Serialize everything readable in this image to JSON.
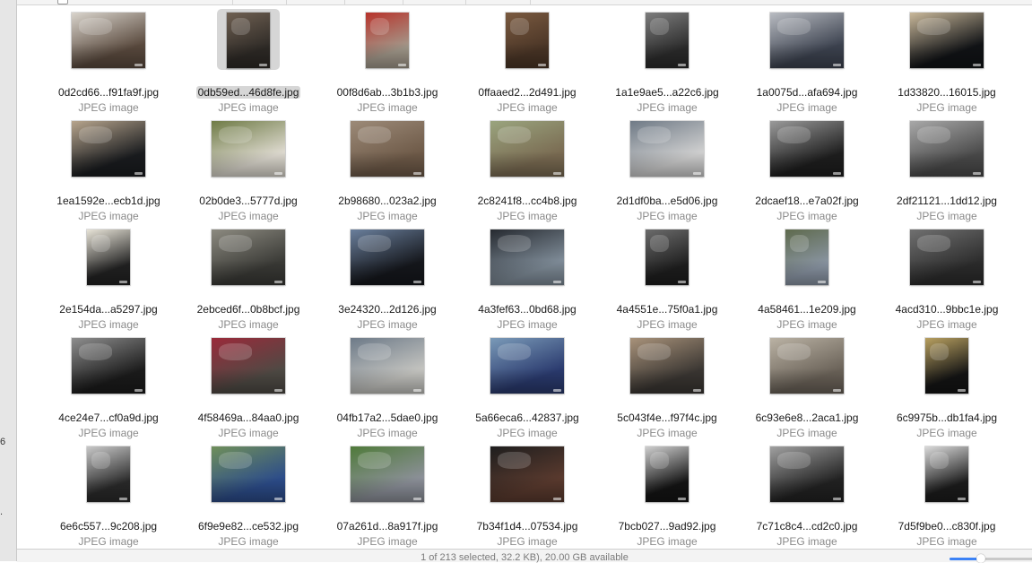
{
  "sidebar": {
    "fragments": [
      "6",
      "."
    ]
  },
  "items": [
    {
      "name": "0d2cd66...f91fa9f.jpg",
      "type": "JPEG image",
      "thumb": "land",
      "colors": [
        "#5a4a3e",
        "#d9d4cc"
      ]
    },
    {
      "name": "0db59ed...46d8fe.jpg",
      "type": "JPEG image",
      "thumb": "tall",
      "selected": true,
      "colors": [
        "#2e2a26",
        "#6f6052"
      ]
    },
    {
      "name": "00f8d6ab...3b1b3.jpg",
      "type": "JPEG image",
      "thumb": "tall",
      "colors": [
        "#a39a8c",
        "#b8332b"
      ]
    },
    {
      "name": "0ffaaed2...2d491.jpg",
      "type": "JPEG image",
      "thumb": "tall",
      "colors": [
        "#4a3526",
        "#7a5a40"
      ]
    },
    {
      "name": "1a1e9ae5...a22c6.jpg",
      "type": "JPEG image",
      "thumb": "tall",
      "colors": [
        "#2b2b2b",
        "#7d7d7d"
      ]
    },
    {
      "name": "1a0075d...afa694.jpg",
      "type": "JPEG image",
      "thumb": "land",
      "colors": [
        "#3d4350",
        "#b9bcc2"
      ]
    },
    {
      "name": "1d33820...16015.jpg",
      "type": "JPEG image",
      "thumb": "land",
      "colors": [
        "#111316",
        "#c9b89a"
      ]
    },
    {
      "name": "1ea1592e...ecb1d.jpg",
      "type": "JPEG image",
      "thumb": "land",
      "colors": [
        "#1a1c1f",
        "#b7a58d"
      ]
    },
    {
      "name": "02b0de3...5777d.jpg",
      "type": "JPEG image",
      "thumb": "land",
      "colors": [
        "#dedad0",
        "#6f7b46"
      ]
    },
    {
      "name": "2b98680...023a2.jpg",
      "type": "JPEG image",
      "thumb": "land",
      "colors": [
        "#6e5a48",
        "#9c8a78"
      ]
    },
    {
      "name": "2c8241f8...cc4b8.jpg",
      "type": "JPEG image",
      "thumb": "land",
      "colors": [
        "#7a6b52",
        "#9aa47e"
      ]
    },
    {
      "name": "2d1df0ba...e5d06.jpg",
      "type": "JPEG image",
      "thumb": "land",
      "colors": [
        "#d0d0d0",
        "#6f7a86"
      ]
    },
    {
      "name": "2dcaef18...e7a02f.jpg",
      "type": "JPEG image",
      "thumb": "land",
      "colors": [
        "#1e1e1e",
        "#9a9a9a"
      ]
    },
    {
      "name": "2df21121...1dd12.jpg",
      "type": "JPEG image",
      "thumb": "land",
      "colors": [
        "#4a4a4a",
        "#a8a8a8"
      ]
    },
    {
      "name": "2e154da...a5297.jpg",
      "type": "JPEG image",
      "thumb": "tall",
      "colors": [
        "#222222",
        "#e8e4d8"
      ]
    },
    {
      "name": "2ebced6f...0b8bcf.jpg",
      "type": "JPEG image",
      "thumb": "land",
      "colors": [
        "#3a3a36",
        "#8c8a80"
      ]
    },
    {
      "name": "3e24320...2d126.jpg",
      "type": "JPEG image",
      "thumb": "land",
      "colors": [
        "#15171c",
        "#6a7f9c"
      ]
    },
    {
      "name": "4a3fef63...0bd68.jpg",
      "type": "JPEG image",
      "thumb": "land",
      "colors": [
        "#7f8c98",
        "#262a30"
      ]
    },
    {
      "name": "4a4551e...75f0a1.jpg",
      "type": "JPEG image",
      "thumb": "tall",
      "colors": [
        "#1e1e1e",
        "#6b6b6b"
      ]
    },
    {
      "name": "4a58461...1e209.jpg",
      "type": "JPEG image",
      "thumb": "tall",
      "colors": [
        "#8a95a3",
        "#5e6a4d"
      ]
    },
    {
      "name": "4acd310...9bbc1e.jpg",
      "type": "JPEG image",
      "thumb": "land",
      "colors": [
        "#2c2c2c",
        "#707070"
      ]
    },
    {
      "name": "4ce24e7...cf0a9d.jpg",
      "type": "JPEG image",
      "thumb": "land",
      "colors": [
        "#1b1b1b",
        "#8e8e8e"
      ]
    },
    {
      "name": "4f58469a...84aa0.jpg",
      "type": "JPEG image",
      "thumb": "land",
      "colors": [
        "#4e4a44",
        "#9a2a3a"
      ]
    },
    {
      "name": "04fb17a2...5dae0.jpg",
      "type": "JPEG image",
      "thumb": "land",
      "colors": [
        "#c4c4c0",
        "#6d7a88"
      ]
    },
    {
      "name": "5a66eca6...42837.jpg",
      "type": "JPEG image",
      "thumb": "land",
      "colors": [
        "#2a3a6e",
        "#7a9ab8"
      ]
    },
    {
      "name": "5c043f4e...f97f4c.jpg",
      "type": "JPEG image",
      "thumb": "land",
      "colors": [
        "#3a3632",
        "#a8927a"
      ]
    },
    {
      "name": "6c93e6e8...2aca1.jpg",
      "type": "JPEG image",
      "thumb": "land",
      "colors": [
        "#6a6258",
        "#bab2a4"
      ]
    },
    {
      "name": "6c9975b...db1fa4.jpg",
      "type": "JPEG image",
      "thumb": "tall",
      "colors": [
        "#141414",
        "#b8a060"
      ]
    },
    {
      "name": "6e6c557...9c208.jpg",
      "type": "JPEG image",
      "thumb": "tall",
      "colors": [
        "#2a2a2a",
        "#c8c8c8"
      ]
    },
    {
      "name": "6f9e9e82...ce532.jpg",
      "type": "JPEG image",
      "thumb": "land",
      "colors": [
        "#2c4c8a",
        "#6f8f5a"
      ]
    },
    {
      "name": "07a261d...8a917f.jpg",
      "type": "JPEG image",
      "thumb": "land",
      "colors": [
        "#8c9099",
        "#4f7a3a"
      ]
    },
    {
      "name": "7b34f1d4...07534.jpg",
      "type": "JPEG image",
      "thumb": "land",
      "colors": [
        "#5a3a2e",
        "#1e1e1e"
      ]
    },
    {
      "name": "7bcb027...9ad92.jpg",
      "type": "JPEG image",
      "thumb": "tall",
      "colors": [
        "#141414",
        "#cfcfcf"
      ]
    },
    {
      "name": "7c71c8c4...cd2c0.jpg",
      "type": "JPEG image",
      "thumb": "land",
      "colors": [
        "#222222",
        "#a0a0a0"
      ]
    },
    {
      "name": "7d5f9be0...c830f.jpg",
      "type": "JPEG image",
      "thumb": "tall",
      "colors": [
        "#1c1c1c",
        "#dadada"
      ]
    }
  ],
  "status": {
    "text": "1 of 213 selected, 32.2 KB), 20.00 GB available",
    "zoom": 0.35
  }
}
